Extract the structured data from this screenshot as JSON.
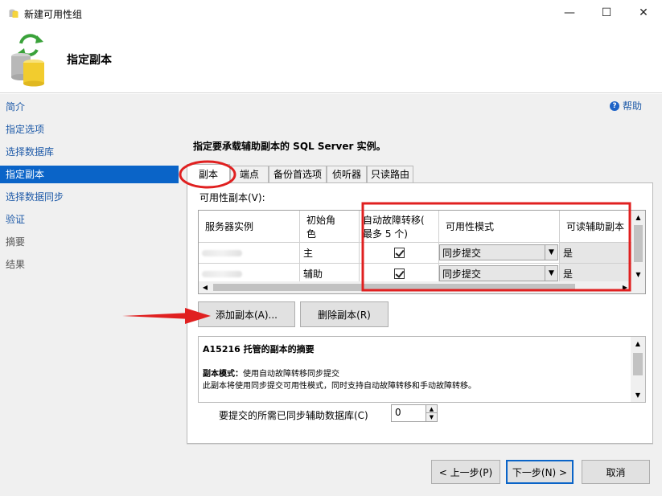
{
  "window": {
    "title": "新建可用性组",
    "minimize_glyph": "—",
    "maximize_glyph": "☐",
    "close_glyph": "✕"
  },
  "header": {
    "title": "指定副本"
  },
  "sidebar": {
    "items": [
      {
        "label": "简介",
        "state": "link"
      },
      {
        "label": "指定选项",
        "state": "link"
      },
      {
        "label": "选择数据库",
        "state": "link"
      },
      {
        "label": "指定副本",
        "state": "active"
      },
      {
        "label": "选择数据同步",
        "state": "link"
      },
      {
        "label": "验证",
        "state": "link"
      },
      {
        "label": "摘要",
        "state": "disabled"
      },
      {
        "label": "结果",
        "state": "disabled"
      }
    ]
  },
  "help": {
    "label": "帮助"
  },
  "instruction": "指定要承载辅助副本的 SQL Server 实例。",
  "tabs": [
    {
      "label": "副本",
      "active": true
    },
    {
      "label": "端点",
      "active": false
    },
    {
      "label": "备份首选项",
      "active": false
    },
    {
      "label": "侦听器",
      "active": false
    },
    {
      "label": "只读路由",
      "active": false
    }
  ],
  "grid": {
    "label": "可用性副本(V):",
    "headers": {
      "server": "服务器实例",
      "role_line1": "初始角",
      "role_line2": "色",
      "failover_line1": "自动故障转移(",
      "failover_line2": "最多 5 个)",
      "mode": "可用性模式",
      "readable": "可读辅助副本"
    },
    "rows": [
      {
        "role": "主",
        "failover": true,
        "mode": "同步提交",
        "readable": "是"
      },
      {
        "role": "辅助",
        "failover": true,
        "mode": "同步提交",
        "readable": "是"
      }
    ]
  },
  "buttons": {
    "add_replica": "添加副本(A)...",
    "remove_replica": "删除副本(R)",
    "back": "< 上一步(P)",
    "next": "下一步(N) >",
    "cancel": "取消"
  },
  "summary": {
    "title": "A15216 托管的副本的摘要",
    "mode_label": "副本模式：",
    "mode_value": "使用自动故障转移同步提交",
    "description": "此副本将使用同步提交可用性模式，同时支持自动故障转移和手动故障转移。"
  },
  "sync": {
    "label": "要提交的所需已同步辅助数据库(C)",
    "value": "0"
  },
  "colors": {
    "active_nav": "#0a64c8",
    "link": "#1e5aa8",
    "annotation": "#e02020"
  }
}
